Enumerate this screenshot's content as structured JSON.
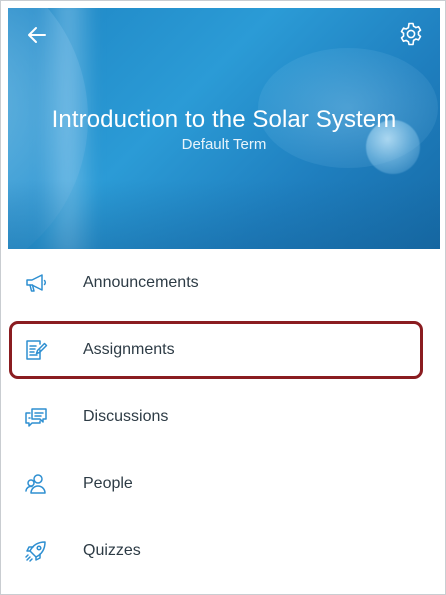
{
  "header": {
    "back_icon": "arrow-left-icon",
    "settings_icon": "gear-icon",
    "title": "Introduction to the Solar System",
    "term": "Default Term"
  },
  "menu": {
    "items": [
      {
        "label": "Announcements",
        "icon": "megaphone-icon"
      },
      {
        "label": "Assignments",
        "icon": "assignment-icon",
        "highlighted": true
      },
      {
        "label": "Discussions",
        "icon": "discussions-icon"
      },
      {
        "label": "People",
        "icon": "people-icon"
      },
      {
        "label": "Quizzes",
        "icon": "rocket-icon"
      }
    ]
  },
  "colors": {
    "hero_blue": "#2b9bd6",
    "icon_blue": "#2e8fd1",
    "text_dark": "#2d3b45",
    "highlight_border": "#8a1c20"
  }
}
